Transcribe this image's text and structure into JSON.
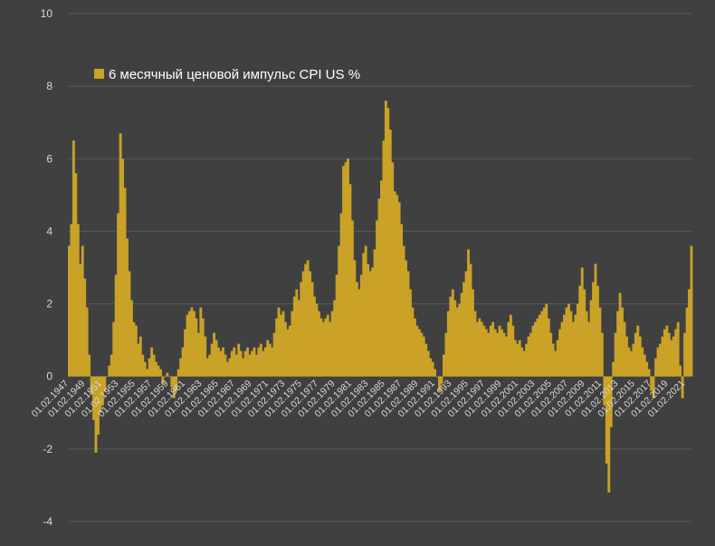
{
  "colors": {
    "background": "#404040",
    "gridline": "#595959",
    "axis_text": "#d9d9d9",
    "bar": "#c9a227",
    "legend_text": "#ffffff"
  },
  "chart_data": {
    "type": "bar",
    "title": "",
    "xlabel": "",
    "ylabel": "",
    "ylim": [
      -4,
      10
    ],
    "yticks": [
      -4,
      -2,
      0,
      2,
      4,
      6,
      8,
      10
    ],
    "grid": true,
    "legend_position": "top-left",
    "series": [
      {
        "name": "6 месячный ценовой импульс CPI US %",
        "color": "#c9a227",
        "values": [
          3.6,
          4.2,
          6.5,
          5.6,
          4.2,
          3.1,
          3.6,
          2.7,
          1.9,
          0.6,
          -0.5,
          -1.2,
          -2.1,
          -1.6,
          -1.0,
          -0.8,
          -0.4,
          0.0,
          0.3,
          0.6,
          1.5,
          2.8,
          4.5,
          6.7,
          6.0,
          5.2,
          3.8,
          2.9,
          2.1,
          1.5,
          1.4,
          0.9,
          1.1,
          0.6,
          0.4,
          0.2,
          0.5,
          0.8,
          0.6,
          0.4,
          0.3,
          0.2,
          -0.2,
          0.0,
          0.1,
          0.0,
          -0.3,
          -0.6,
          -0.4,
          0.2,
          0.5,
          0.8,
          1.3,
          1.7,
          1.8,
          1.9,
          1.8,
          1.6,
          1.2,
          1.9,
          1.6,
          1.1,
          0.5,
          0.6,
          0.9,
          1.2,
          1.0,
          0.8,
          0.7,
          0.8,
          0.6,
          0.4,
          0.5,
          0.7,
          0.8,
          0.6,
          0.9,
          0.7,
          0.5,
          0.7,
          0.8,
          0.6,
          0.7,
          0.8,
          0.6,
          0.8,
          0.9,
          0.7,
          0.8,
          1.0,
          0.9,
          0.8,
          1.2,
          1.6,
          1.9,
          1.7,
          1.8,
          1.5,
          1.3,
          1.4,
          1.8,
          2.2,
          2.4,
          2.1,
          2.6,
          2.9,
          3.1,
          3.2,
          2.9,
          2.6,
          2.2,
          2.0,
          1.8,
          1.6,
          1.5,
          1.6,
          1.7,
          1.5,
          1.8,
          2.1,
          2.8,
          3.6,
          4.5,
          5.8,
          5.9,
          6.0,
          5.3,
          4.3,
          3.2,
          2.6,
          2.4,
          2.8,
          3.4,
          3.6,
          3.1,
          2.9,
          3.0,
          3.5,
          4.3,
          4.9,
          5.4,
          6.5,
          7.6,
          7.4,
          6.8,
          5.9,
          5.1,
          5.0,
          4.8,
          4.2,
          3.6,
          3.2,
          2.9,
          2.4,
          1.9,
          1.6,
          1.4,
          1.3,
          1.2,
          1.1,
          0.9,
          0.7,
          0.5,
          0.4,
          0.2,
          0.0,
          -0.4,
          -0.2,
          0.6,
          1.2,
          1.8,
          2.2,
          2.4,
          2.1,
          1.9,
          2.0,
          2.3,
          2.6,
          2.9,
          3.5,
          3.1,
          2.4,
          1.8,
          1.5,
          1.6,
          1.5,
          1.4,
          1.3,
          1.2,
          1.4,
          1.5,
          1.3,
          1.2,
          1.4,
          1.3,
          1.2,
          1.1,
          1.5,
          1.7,
          1.4,
          1.0,
          0.9,
          1.0,
          0.8,
          0.7,
          0.9,
          1.1,
          1.2,
          1.4,
          1.5,
          1.6,
          1.7,
          1.8,
          1.9,
          2.0,
          1.6,
          1.2,
          0.9,
          0.7,
          1.0,
          1.3,
          1.5,
          1.7,
          1.9,
          2.0,
          1.8,
          1.5,
          1.7,
          2.0,
          2.5,
          3.0,
          2.4,
          1.8,
          1.5,
          2.1,
          2.6,
          3.1,
          2.5,
          1.9,
          1.2,
          -0.8,
          -2.4,
          -3.2,
          -1.4,
          0.4,
          1.2,
          1.8,
          2.3,
          1.9,
          1.5,
          1.1,
          0.8,
          0.7,
          0.9,
          1.2,
          1.4,
          1.1,
          0.8,
          0.6,
          0.4,
          0.2,
          -0.4,
          -0.6,
          0.5,
          0.8,
          0.9,
          1.1,
          1.3,
          1.4,
          1.2,
          1.0,
          1.1,
          1.3,
          1.5,
          0.3,
          -0.6,
          1.2,
          1.9,
          2.4,
          3.6
        ]
      }
    ],
    "x_tick_labels": [
      "01.02.1947",
      "01.02.1949",
      "01.02.1951",
      "01.02.1953",
      "01.02.1955",
      "01.02.1957",
      "01.02.1959",
      "01.02.1961",
      "01.02.1963",
      "01.02.1965",
      "01.02.1967",
      "01.02.1969",
      "01.02.1971",
      "01.02.1973",
      "01.02.1975",
      "01.02.1977",
      "01.02.1979",
      "01.02.1981",
      "01.02.1983",
      "01.02.1985",
      "01.02.1987",
      "01.02.1989",
      "01.02.1991",
      "01.02.1993",
      "01.02.1995",
      "01.02.1997",
      "01.02.1999",
      "01.02.2001",
      "01.02.2003",
      "01.02.2005",
      "01.02.2007",
      "01.02.2009",
      "01.02.2011",
      "01.02.2013",
      "01.02.2015",
      "01.02.2017",
      "01.02.2019",
      "01.02.2021"
    ]
  }
}
